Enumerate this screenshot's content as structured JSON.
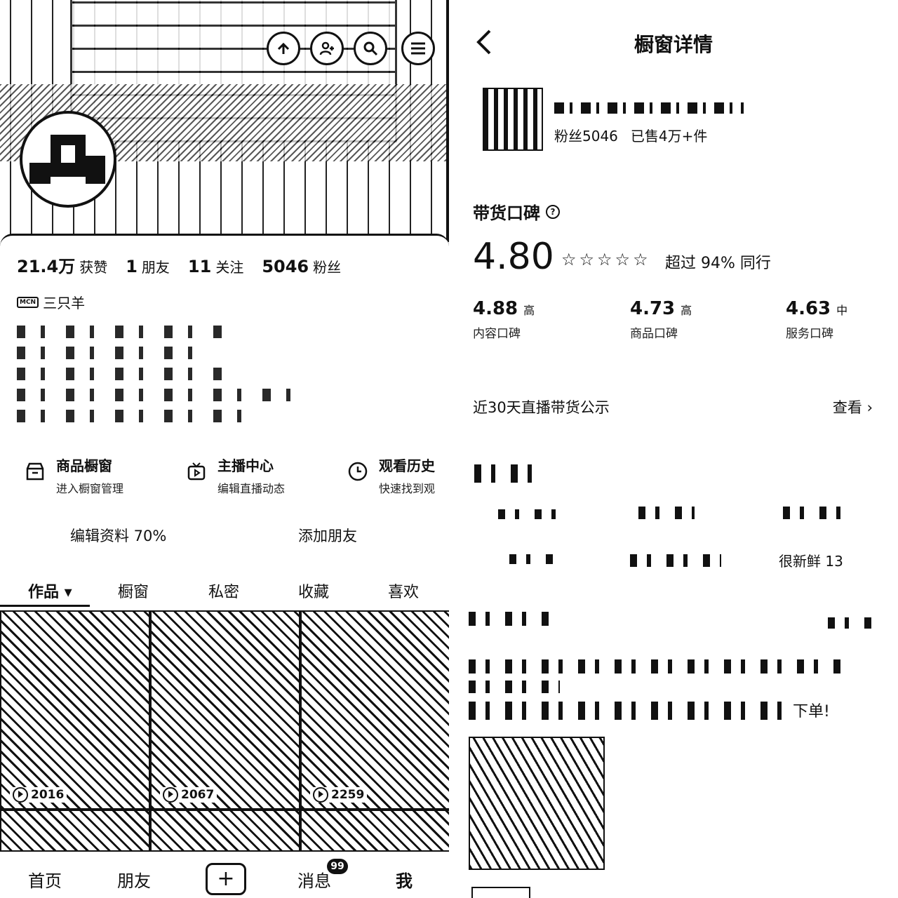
{
  "left": {
    "stats": [
      {
        "value": "21.4万",
        "label": "获赞"
      },
      {
        "value": "1",
        "label": "朋友"
      },
      {
        "value": "11",
        "label": "关注"
      },
      {
        "value": "5046",
        "label": "粉丝"
      }
    ],
    "mcn_badge": "MCN",
    "mcn_name": "三只羊",
    "shortcuts": [
      {
        "title": "商品橱窗",
        "subtitle": "进入橱窗管理",
        "icon": "storefront-icon"
      },
      {
        "title": "主播中心",
        "subtitle": "编辑直播动态",
        "icon": "tv-icon"
      },
      {
        "title": "观看历史",
        "subtitle": "快速找到观",
        "icon": "clock-icon"
      }
    ],
    "edit_profile": "编辑资料 70%",
    "add_friend": "添加朋友",
    "tabs": [
      "作品 ▾",
      "橱窗",
      "私密",
      "收藏",
      "喜欢"
    ],
    "videos": [
      {
        "plays": "2016"
      },
      {
        "plays": "2067"
      },
      {
        "plays": "2259"
      }
    ],
    "bottom_nav": [
      "首页",
      "朋友",
      "+",
      "消息",
      "我"
    ],
    "message_badge": "99"
  },
  "right": {
    "title": "橱窗详情",
    "back_icon": "chevron-left-icon",
    "shop_meta_fans": "粉丝5046",
    "shop_meta_sold": "已售4万+件",
    "section_title": "带货口碑",
    "score": "4.80",
    "stars": 4.8,
    "beat_text": "超过 94% 同行",
    "subscores": [
      {
        "value": "4.88",
        "level": "高",
        "label": "内容口碑"
      },
      {
        "value": "4.73",
        "level": "高",
        "label": "商品口碑"
      },
      {
        "value": "4.63",
        "level": "中",
        "label": "服务口碑"
      }
    ],
    "live_title": "近30天直播带货公示",
    "live_action": "查看",
    "fresh_text": "很新鲜 13",
    "order_text": "下单!"
  }
}
